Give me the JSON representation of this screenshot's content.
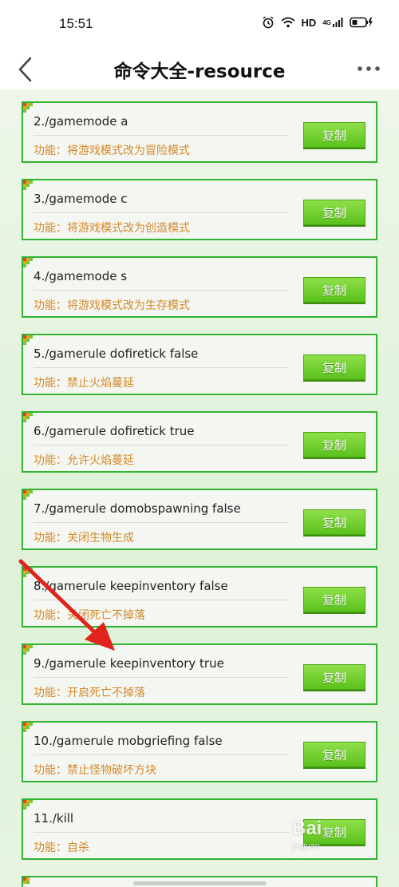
{
  "status_bar": {
    "time": "15:51",
    "network": "HD",
    "signal_label": "4G"
  },
  "header": {
    "title": "命令大全-resource"
  },
  "commands": [
    {
      "command": "2./gamemode a",
      "function": "功能：将游戏模式改为冒险模式",
      "copy_label": "复制"
    },
    {
      "command": "3./gamemode c",
      "function": "功能：将游戏模式改为创造模式",
      "copy_label": "复制"
    },
    {
      "command": "4./gamemode s",
      "function": "功能：将游戏模式改为生存模式",
      "copy_label": "复制"
    },
    {
      "command": "5./gamerule dofiretick false",
      "function": "功能：禁止火焰蔓延",
      "copy_label": "复制"
    },
    {
      "command": "6./gamerule dofiretick true",
      "function": "功能：允许火焰蔓延",
      "copy_label": "复制"
    },
    {
      "command": "7./gamerule domobspawning false",
      "function": "功能：关闭生物生成",
      "copy_label": "复制"
    },
    {
      "command": "8./gamerule keepinventory false",
      "function": "功能：关闭死亡不掉落",
      "copy_label": "复制"
    },
    {
      "command": "9./gamerule keepinventory true",
      "function": "功能：开启死亡不掉落",
      "copy_label": "复制"
    },
    {
      "command": "10./gamerule mobgriefing false",
      "function": "功能：禁止怪物破坏方块",
      "copy_label": "复制"
    },
    {
      "command": "11./kill",
      "function": "功能：自杀",
      "copy_label": "复制"
    }
  ],
  "watermark": {
    "text": "Bai",
    "sub": "jingyan"
  },
  "colors": {
    "card_border": "#33b233",
    "function_text": "#d38a2a",
    "copy_button": "#5bc21c",
    "annotation_arrow": "#e0231c"
  }
}
